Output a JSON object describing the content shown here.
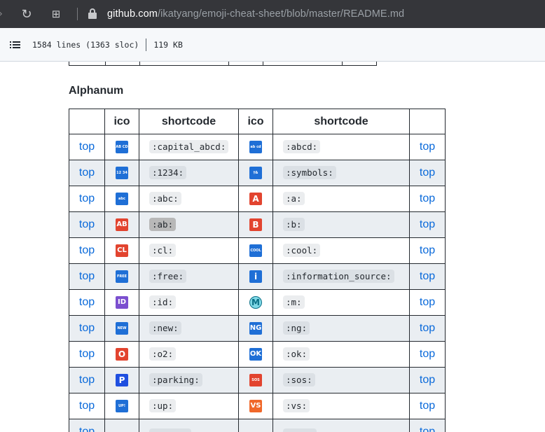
{
  "browser": {
    "url_host": "github.com",
    "url_path": "/ikatyang/emoji-cheat-sheet/blob/master/README.md"
  },
  "file_info": {
    "lines": "1584 lines (1363 sloc)",
    "size": "119 KB"
  },
  "section": {
    "title": "Alphanum"
  },
  "table": {
    "headers": [
      "",
      "ico",
      "shortcode",
      "ico",
      "shortcode",
      ""
    ],
    "top_label": "top",
    "rows": [
      {
        "left_code": ":capital_abcd:",
        "left_icon": {
          "name": "capital-abcd-icon",
          "glyph": "AB CD",
          "color": "#1f6fd6"
        },
        "right_code": ":abcd:",
        "right_icon": {
          "name": "abcd-icon",
          "glyph": "ab cd",
          "color": "#1f6fd6"
        }
      },
      {
        "left_code": ":1234:",
        "left_icon": {
          "name": "input-numbers-icon",
          "glyph": "12 34",
          "color": "#1f6fd6"
        },
        "right_code": ":symbols:",
        "right_icon": {
          "name": "input-symbols-icon",
          "glyph": "†& @%",
          "color": "#1f6fd6"
        }
      },
      {
        "left_code": ":abc:",
        "left_icon": {
          "name": "abc-icon",
          "glyph": "abc",
          "color": "#1f6fd6"
        },
        "right_code": ":a:",
        "right_icon": {
          "name": "a-button-icon",
          "glyph": "A",
          "color": "#e2442f"
        }
      },
      {
        "left_code": ":ab:",
        "left_icon": {
          "name": "ab-button-icon",
          "glyph": "AB",
          "color": "#e2442f"
        },
        "right_code": ":b:",
        "right_icon": {
          "name": "b-button-icon",
          "glyph": "B",
          "color": "#e2442f"
        }
      },
      {
        "left_code": ":cl:",
        "left_icon": {
          "name": "cl-button-icon",
          "glyph": "CL",
          "color": "#e2442f"
        },
        "right_code": ":cool:",
        "right_icon": {
          "name": "cool-button-icon",
          "glyph": "COOL",
          "color": "#1f6fd6"
        }
      },
      {
        "left_code": ":free:",
        "left_icon": {
          "name": "free-button-icon",
          "glyph": "FREE",
          "color": "#1f6fd6"
        },
        "right_code": ":information_source:",
        "right_icon": {
          "name": "information-icon",
          "glyph": "i",
          "color": "#1f6fd6"
        }
      },
      {
        "left_code": ":id:",
        "left_icon": {
          "name": "id-button-icon",
          "glyph": "ID",
          "color": "#7b4fcf"
        },
        "right_code": ":m:",
        "right_icon": {
          "name": "circled-m-icon",
          "glyph": "M",
          "color": "#26a8c9"
        }
      },
      {
        "left_code": ":new:",
        "left_icon": {
          "name": "new-button-icon",
          "glyph": "NEW",
          "color": "#1f6fd6"
        },
        "right_code": ":ng:",
        "right_icon": {
          "name": "ng-button-icon",
          "glyph": "NG",
          "color": "#1f6fd6"
        }
      },
      {
        "left_code": ":o2:",
        "left_icon": {
          "name": "o-button-icon",
          "glyph": "O",
          "color": "#e2442f"
        },
        "right_code": ":ok:",
        "right_icon": {
          "name": "ok-button-icon",
          "glyph": "OK",
          "color": "#1f6fd6"
        }
      },
      {
        "left_code": ":parking:",
        "left_icon": {
          "name": "p-button-icon",
          "glyph": "P",
          "color": "#1f4fe0"
        },
        "right_code": ":sos:",
        "right_icon": {
          "name": "sos-button-icon",
          "glyph": "SOS",
          "color": "#e2442f"
        }
      },
      {
        "left_code": ":up:",
        "left_icon": {
          "name": "up-button-icon",
          "glyph": "UP!",
          "color": "#1f6fd6"
        },
        "right_code": ":vs:",
        "right_icon": {
          "name": "vs-button-icon",
          "glyph": "VS",
          "color": "#f0682a"
        }
      },
      {
        "left_code": "",
        "left_icon": {
          "name": "partial-icon",
          "glyph": "",
          "color": "#1f6fd6"
        },
        "right_code": "",
        "right_icon": {
          "name": "partial-icon",
          "glyph": "",
          "color": "#1f6fd6"
        }
      }
    ]
  }
}
